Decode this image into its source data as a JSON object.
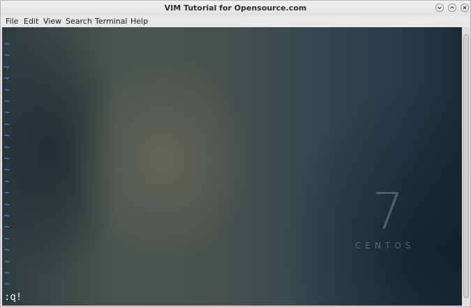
{
  "window": {
    "title": "VIM Tutorial for Opensource.com",
    "controls": [
      "minimize",
      "maximize",
      "close"
    ]
  },
  "menubar": {
    "items": [
      "File",
      "Edit",
      "View",
      "Search",
      "Terminal",
      "Help"
    ]
  },
  "terminal": {
    "empty_line_marker": "~",
    "command_line": ":q!"
  },
  "wallpaper": {
    "number": "7",
    "brand": "CENTOS"
  },
  "colors": {
    "tilde": "#5b87ff",
    "command_text": "#f2f2f2"
  },
  "icons": {
    "minimize": "chevron-down-icon",
    "maximize": "chevron-up-icon",
    "close": "close-icon"
  }
}
